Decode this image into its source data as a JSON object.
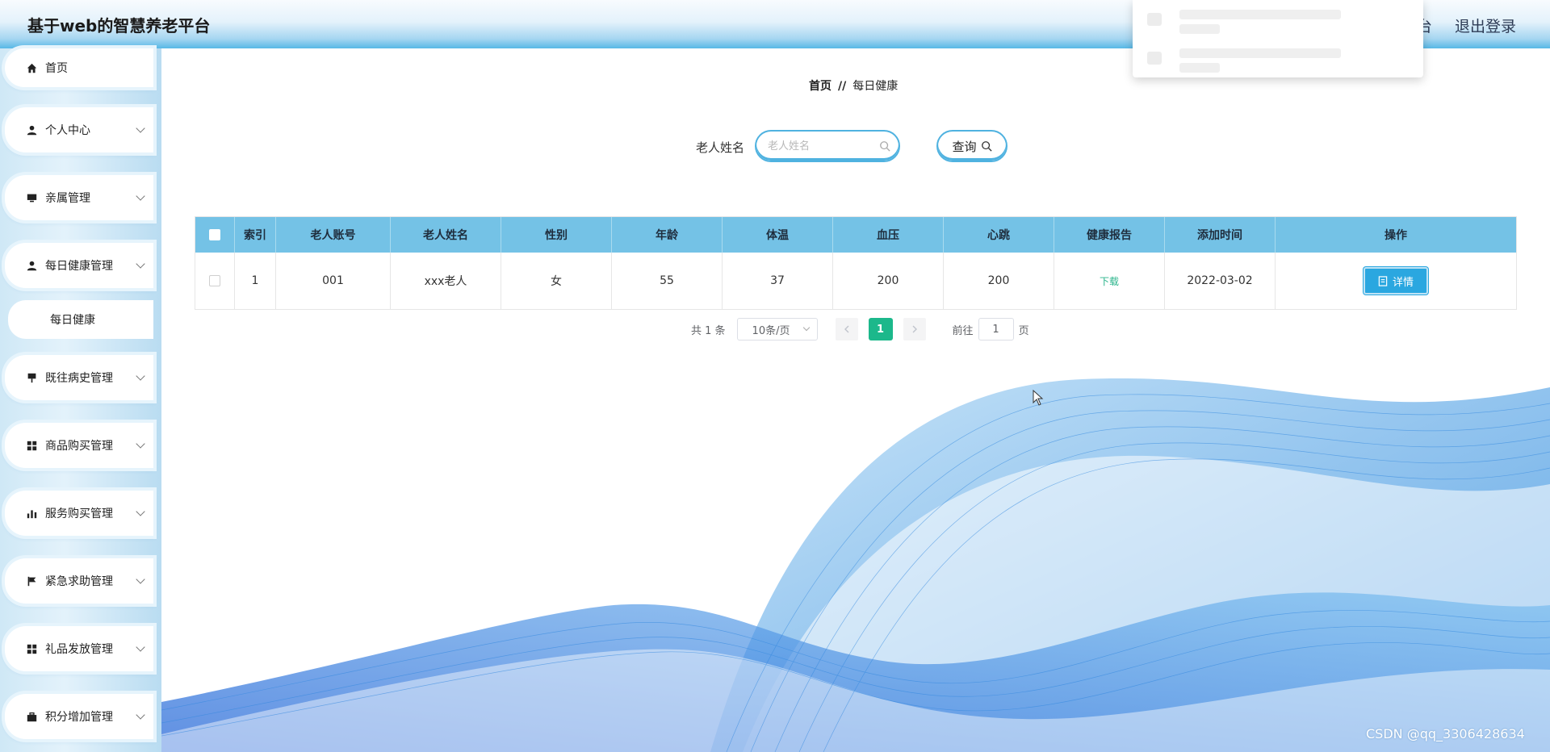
{
  "header": {
    "title": "基于web的智慧养老平台",
    "right_partial": "台",
    "logout": "退出登录"
  },
  "sidebar": {
    "items": [
      {
        "label": "首页",
        "icon": "home-icon"
      },
      {
        "label": "个人中心",
        "icon": "user-icon"
      },
      {
        "label": "亲属管理",
        "icon": "monitor-icon"
      },
      {
        "label": "每日健康管理",
        "icon": "user-icon"
      },
      {
        "label": "每日健康",
        "icon": ""
      },
      {
        "label": "既往病史管理",
        "icon": "pin-icon"
      },
      {
        "label": "商品购买管理",
        "icon": "grid-icon"
      },
      {
        "label": "服务购买管理",
        "icon": "bar-chart-icon"
      },
      {
        "label": "紧急求助管理",
        "icon": "flag-icon"
      },
      {
        "label": "礼品发放管理",
        "icon": "grid-icon"
      },
      {
        "label": "积分增加管理",
        "icon": "briefcase-icon"
      }
    ]
  },
  "breadcrumb": {
    "home": "首页",
    "sep": "//",
    "current": "每日健康"
  },
  "search": {
    "label": "老人姓名",
    "placeholder": "老人姓名",
    "button": "查询"
  },
  "table": {
    "headers": [
      "索引",
      "老人账号",
      "老人姓名",
      "性别",
      "年龄",
      "体温",
      "血压",
      "心跳",
      "健康报告",
      "添加时间",
      "操作"
    ],
    "rows": [
      {
        "index": "1",
        "account": "001",
        "name": "xxx老人",
        "gender": "女",
        "age": "55",
        "temp": "37",
        "bp": "200",
        "hr": "200",
        "report": "下载",
        "time": "2022-03-02",
        "action": "详情"
      }
    ]
  },
  "pagination": {
    "total": "共 1 条",
    "page_size": "10条/页",
    "current_page": "1",
    "goto_label": "前往",
    "goto_value": "1",
    "page_unit": "页"
  },
  "watermark": "CSDN @qq_3306428634",
  "colors": {
    "accent": "#2aa7e0",
    "header_row": "#74c2e6",
    "page_active": "#1cb88b",
    "link": "#2ab48b"
  }
}
